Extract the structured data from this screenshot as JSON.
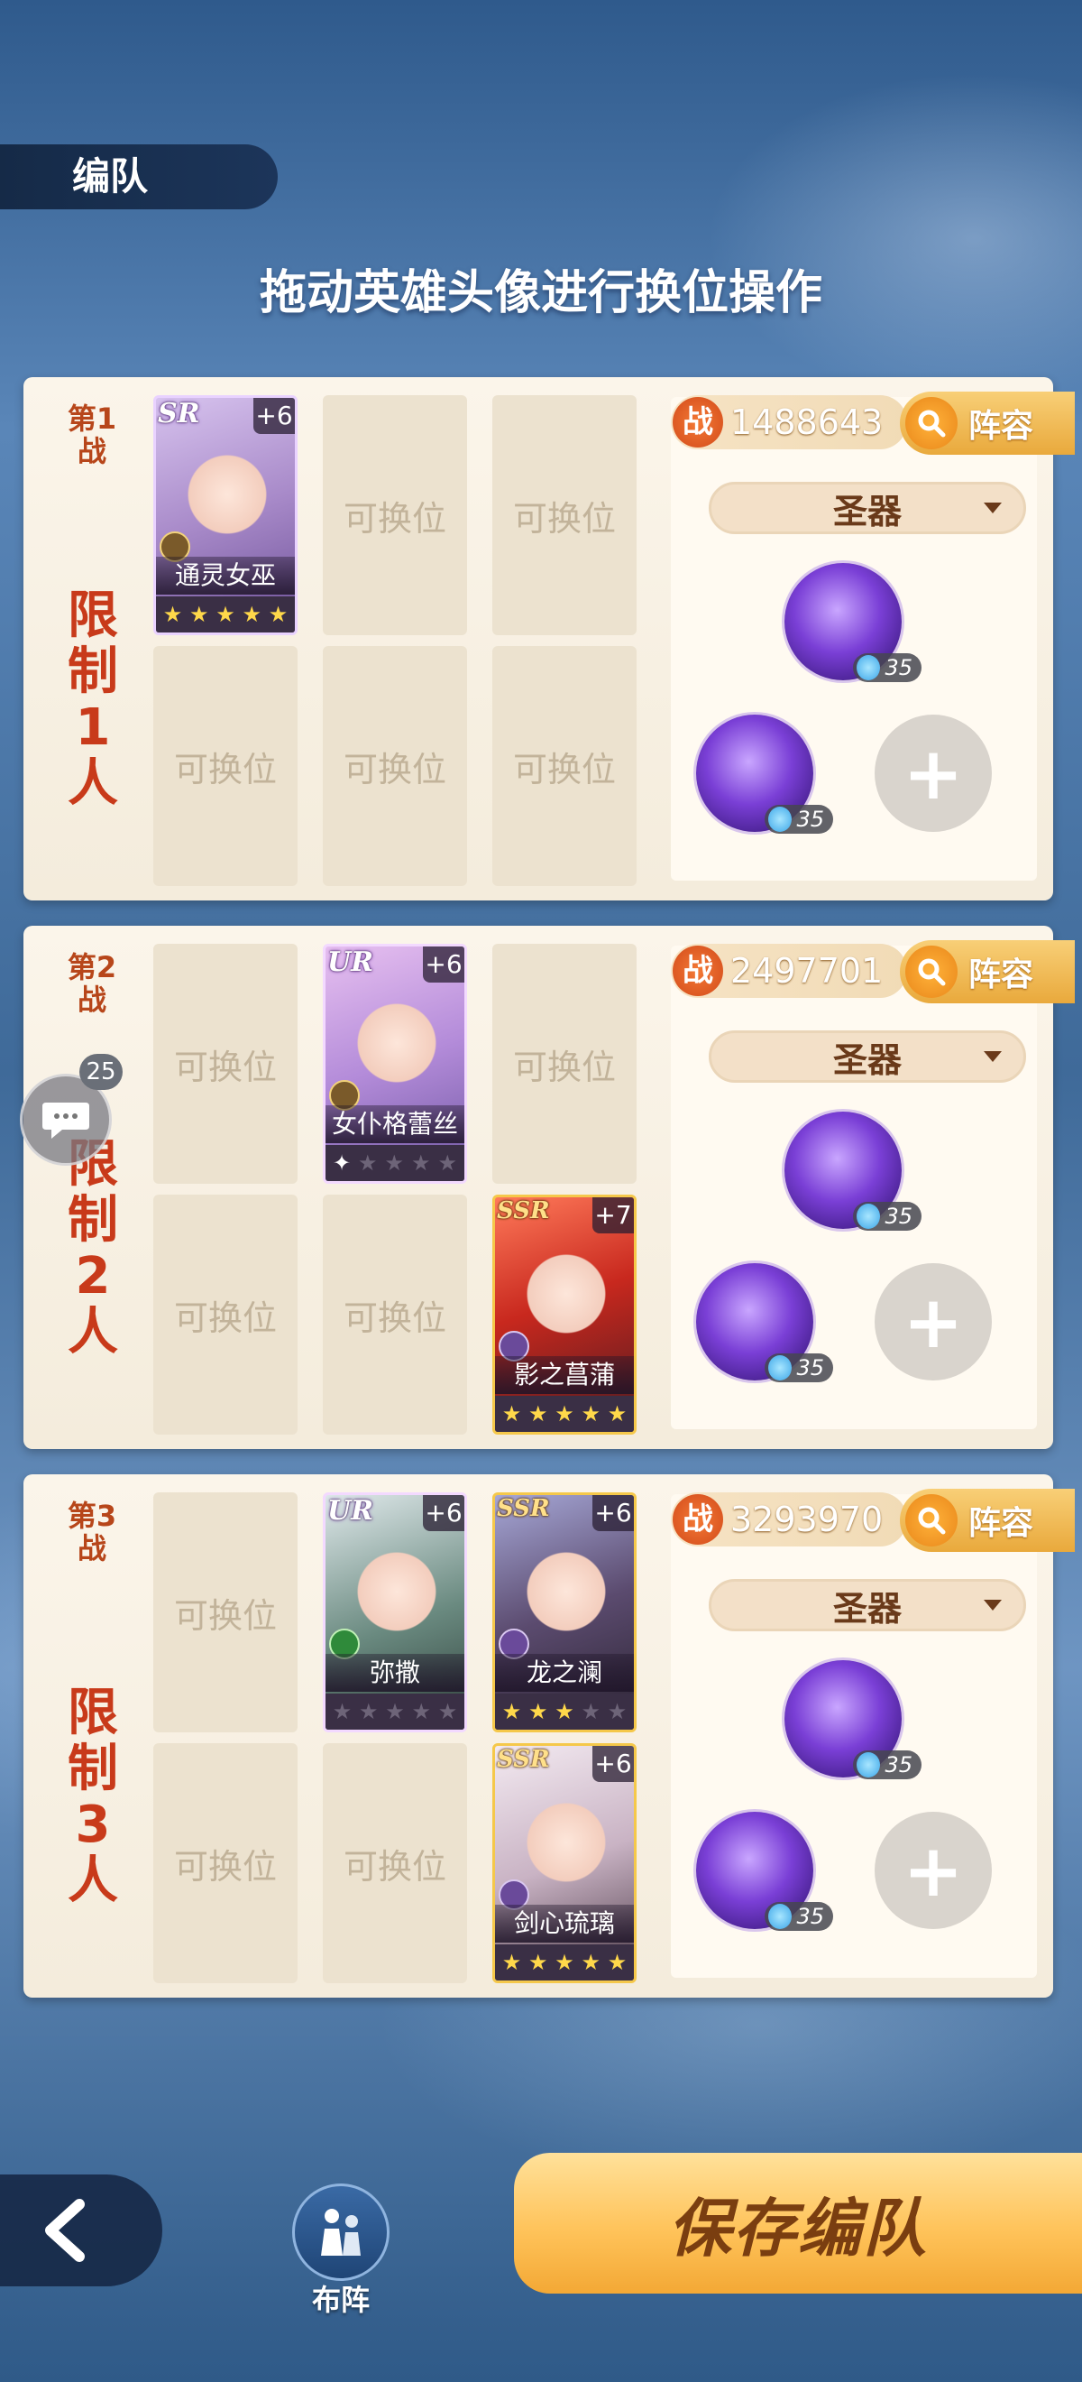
{
  "header": {
    "tab_title": "编队",
    "hint": "拖动英雄头像进行换位操作"
  },
  "common": {
    "empty_slot": "可换位",
    "relic_dropdown": "圣器",
    "lineup_button": "阵容",
    "power_badge": "战",
    "add": "+"
  },
  "battles": [
    {
      "stage_label": "第1战",
      "limit_label": "限制1人",
      "power": "1488643",
      "heroes": [
        {
          "name": "通灵女巫",
          "rarity": "SR",
          "plus": "+6",
          "stars_on": 5
        }
      ],
      "relic_levels": [
        "35",
        "35"
      ]
    },
    {
      "stage_label": "第2战",
      "limit_label": "限制2人",
      "power": "2497701",
      "heroes": [
        {
          "name": "女仆格蕾丝",
          "rarity": "UR",
          "plus": "+6",
          "stars_on": 1
        },
        {
          "name": "影之菖蒲",
          "rarity": "SSR",
          "plus": "+7",
          "stars_on": 5
        }
      ],
      "relic_levels": [
        "35",
        "35"
      ]
    },
    {
      "stage_label": "第3战",
      "limit_label": "限制3人",
      "power": "3293970",
      "heroes": [
        {
          "name": "弥撒",
          "rarity": "UR",
          "plus": "+6",
          "stars_on": 0
        },
        {
          "name": "龙之澜",
          "rarity": "SSR",
          "plus": "+6",
          "stars_on": 3
        },
        {
          "name": "剑心琉璃",
          "rarity": "SSR",
          "plus": "+6",
          "stars_on": 5
        }
      ],
      "relic_levels": [
        "35",
        "35"
      ]
    }
  ],
  "chat": {
    "badge": "25"
  },
  "footer": {
    "formation_label": "布阵",
    "save_label": "保存编队"
  }
}
